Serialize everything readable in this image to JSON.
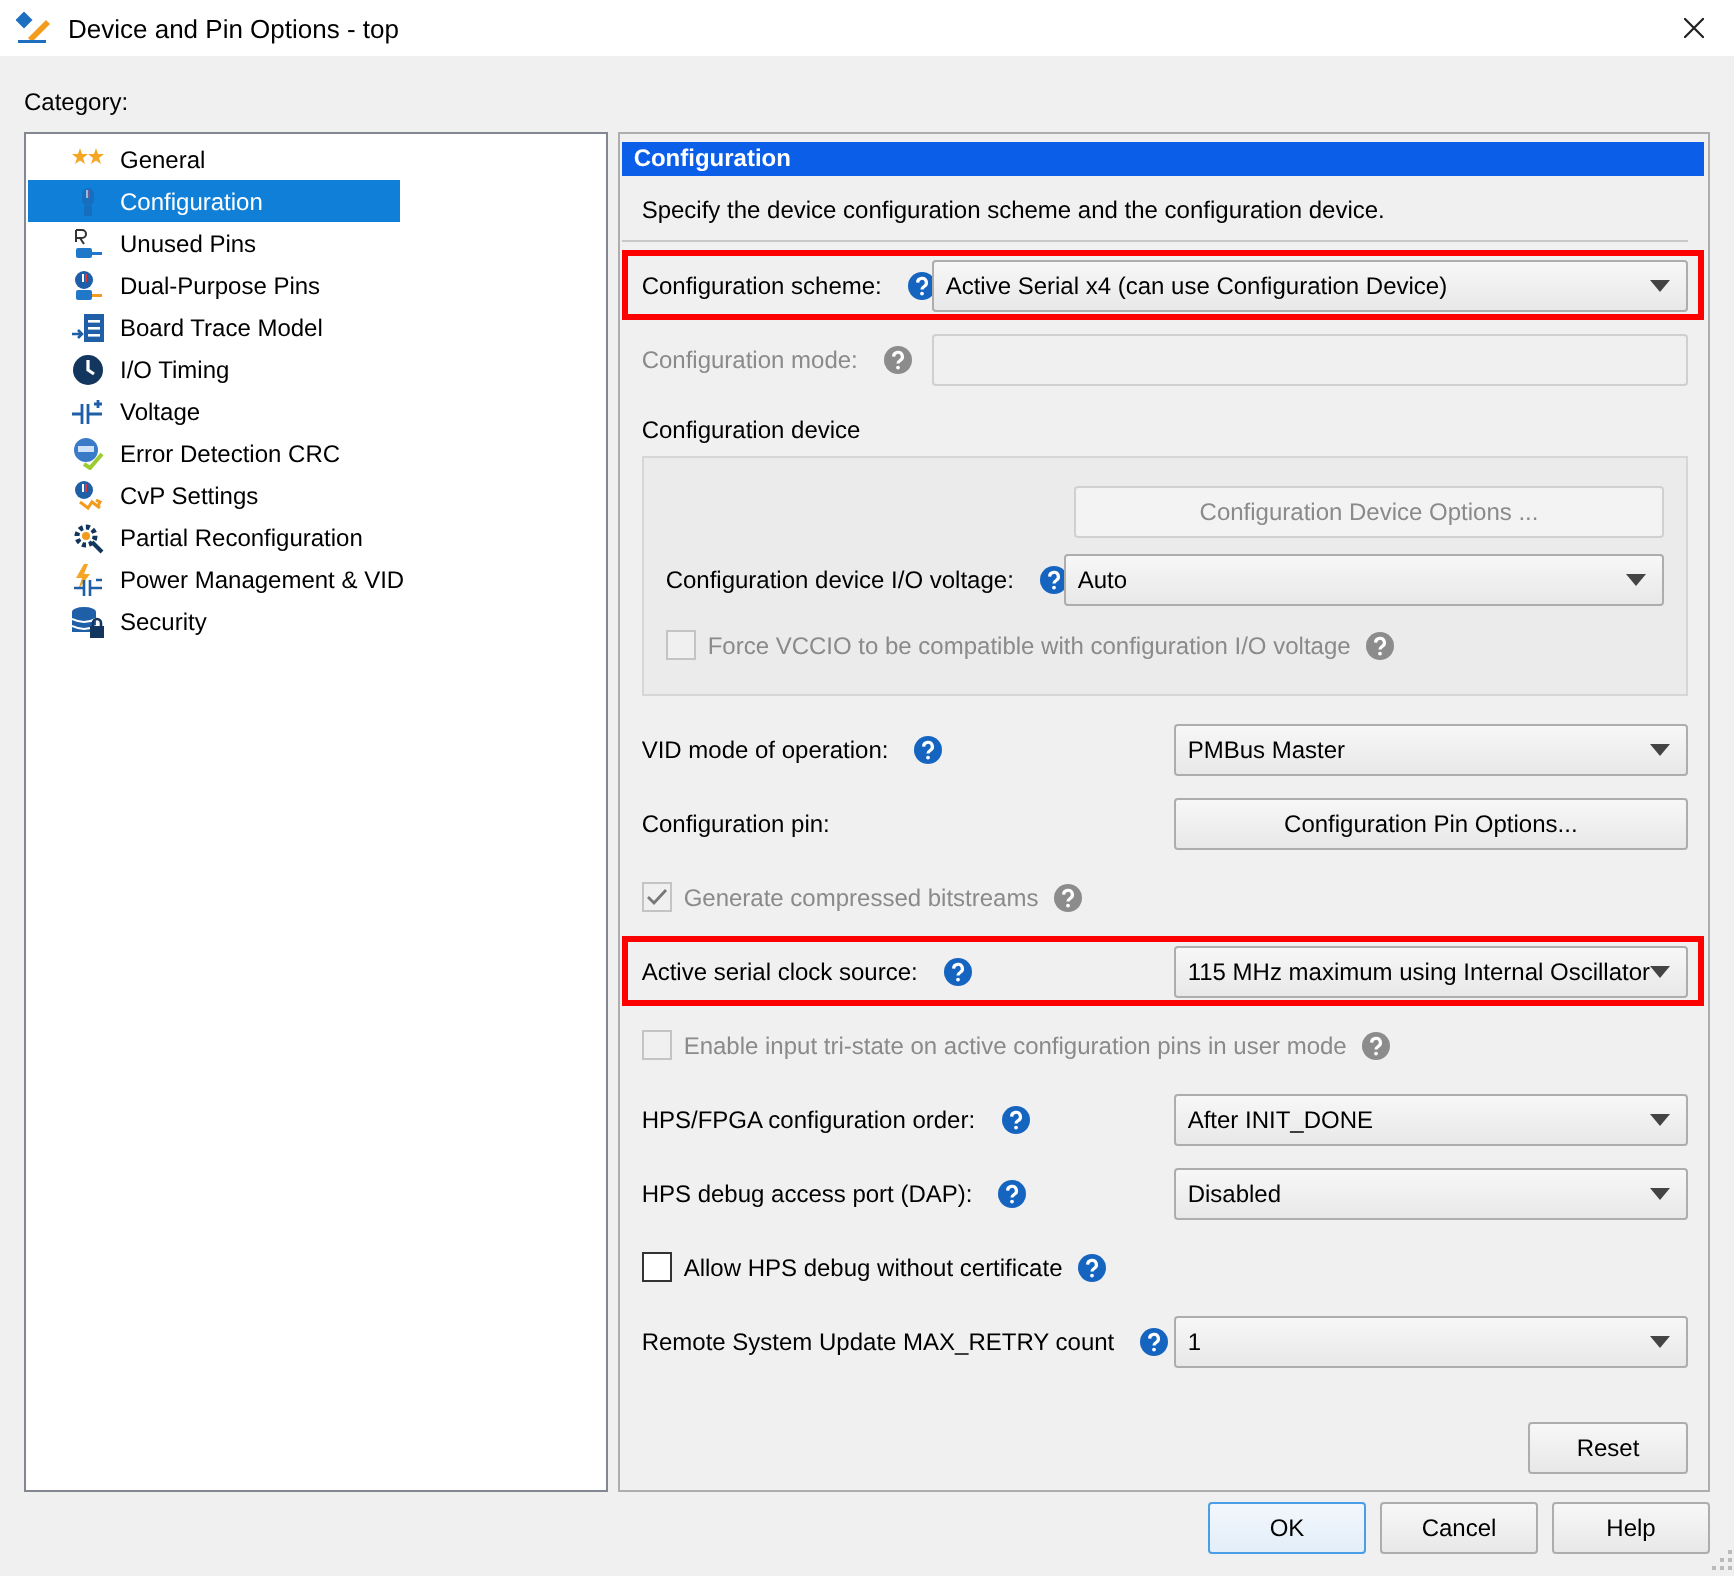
{
  "window": {
    "title": "Device and Pin Options - top"
  },
  "category": {
    "label": "Category:",
    "items": [
      {
        "label": "General",
        "selected": false
      },
      {
        "label": "Configuration",
        "selected": true
      },
      {
        "label": "Unused Pins",
        "selected": false
      },
      {
        "label": "Dual-Purpose Pins",
        "selected": false
      },
      {
        "label": "Board Trace Model",
        "selected": false
      },
      {
        "label": "I/O Timing",
        "selected": false
      },
      {
        "label": "Voltage",
        "selected": false
      },
      {
        "label": "Error Detection CRC",
        "selected": false
      },
      {
        "label": "CvP Settings",
        "selected": false
      },
      {
        "label": "Partial Reconfiguration",
        "selected": false
      },
      {
        "label": "Power Management & VID",
        "selected": false
      },
      {
        "label": "Security",
        "selected": false
      }
    ]
  },
  "panel": {
    "title": "Configuration",
    "description": "Specify the device configuration scheme and the configuration device.",
    "rows": [
      {
        "kind": "combo-wide",
        "label": "Configuration scheme:",
        "help": true,
        "value": "Active Serial x4 (can use Configuration Device)",
        "disabled": false,
        "highlighted": true
      },
      {
        "kind": "field-wide",
        "label": "Configuration mode:",
        "help": true,
        "disabled": true,
        "highlighted": false
      },
      {
        "kind": "group",
        "title": "Configuration device",
        "highlighted": false,
        "rows": [
          {
            "kind": "button",
            "text": "Configuration Device Options ...",
            "disabled": true
          },
          {
            "kind": "combo",
            "label": "Configuration device I/O voltage:",
            "help": true,
            "value": "Auto",
            "disabled": false
          },
          {
            "kind": "checkbox",
            "label": "Force VCCIO to be compatible with configuration I/O voltage",
            "help": true,
            "checked": false,
            "disabled": true
          }
        ]
      },
      {
        "kind": "combo",
        "label": "VID mode of operation:",
        "help": true,
        "value": "PMBus Master",
        "disabled": false,
        "highlighted": false
      },
      {
        "kind": "button",
        "label": "Configuration pin:",
        "help": false,
        "text": "Configuration Pin Options...",
        "disabled": false,
        "highlighted": false
      },
      {
        "kind": "checkbox",
        "label": "Generate compressed bitstreams",
        "help": true,
        "checked": true,
        "disabled": true,
        "highlighted": false
      },
      {
        "kind": "combo",
        "label": "Active serial clock source:",
        "help": true,
        "value": "115 MHz maximum using Internal Oscillator",
        "disabled": false,
        "highlighted": true
      },
      {
        "kind": "checkbox",
        "label": "Enable input tri-state on active configuration pins in user mode",
        "help": true,
        "checked": false,
        "disabled": true,
        "highlighted": false
      },
      {
        "kind": "combo",
        "label": "HPS/FPGA configuration order:",
        "help": true,
        "value": "After INIT_DONE",
        "disabled": false,
        "highlighted": false
      },
      {
        "kind": "combo",
        "label": "HPS debug access port (DAP):",
        "help": true,
        "value": "Disabled",
        "disabled": false,
        "highlighted": false
      },
      {
        "kind": "checkbox",
        "label": "Allow HPS debug without certificate",
        "help": true,
        "checked": false,
        "disabled": false,
        "highlighted": false
      },
      {
        "kind": "combo",
        "label": "Remote System Update MAX_RETRY count",
        "help": true,
        "value": "1",
        "disabled": false,
        "highlighted": false
      }
    ],
    "reset_button": "Reset"
  },
  "buttons": [
    {
      "label": "OK",
      "default": true
    },
    {
      "label": "Cancel",
      "default": false
    },
    {
      "label": "Help",
      "default": false
    }
  ]
}
